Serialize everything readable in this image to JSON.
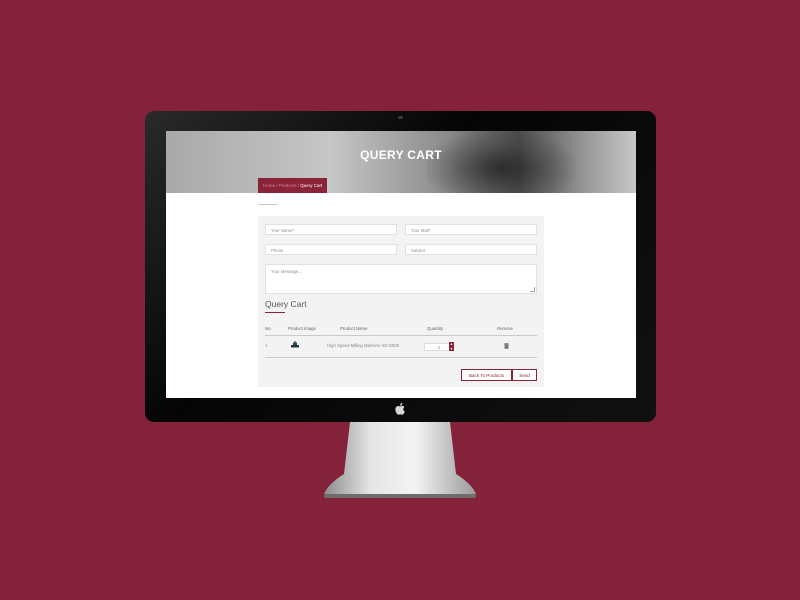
{
  "hero": {
    "title": "QUERY CART",
    "breadcrumb_parent": "Home  /  Products  /",
    "breadcrumb_current": "Query Cart"
  },
  "form": {
    "name_placeholder": "Your Name*",
    "mail_placeholder": "Your Mail*",
    "phone_placeholder": "Phone",
    "subject_placeholder": "Subject",
    "message_placeholder": "Your Message..."
  },
  "cart": {
    "title": "Query Cart",
    "columns": [
      "No.",
      "Product Image",
      "Product Name",
      "Quantity",
      "Remove"
    ],
    "rows": [
      {
        "no": "1",
        "product_name": "High Speed Milling Machine XD-D800",
        "quantity": "1"
      }
    ]
  },
  "buttons": {
    "back": "Back To Products",
    "send": "Send"
  },
  "colors": {
    "background": "#83223a",
    "accent": "#8a2238"
  },
  "icons": [
    "apple-logo-icon",
    "product-thumbnail-icon",
    "trash-icon",
    "spinner-arrows-icon"
  ]
}
